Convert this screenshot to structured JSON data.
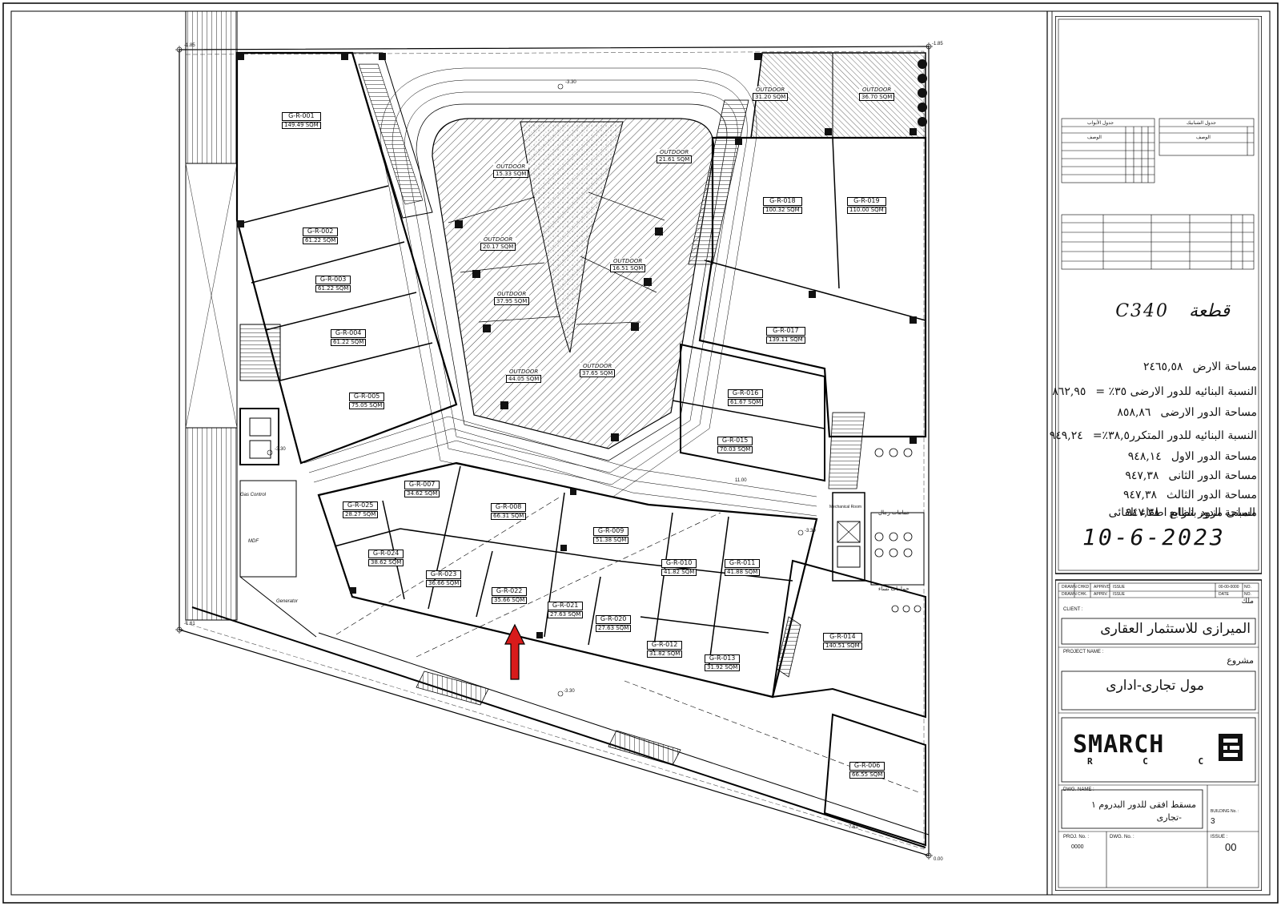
{
  "plot": {
    "title_label": "قطعة",
    "code": "C340",
    "stats": [
      {
        "label": "مساحة الارض",
        "value": "٢٤٦٥,٥٨"
      },
      {
        "label": "النسبة البنائيه للدور الارضى ٣٥٪ =",
        "value": "٨٦٢,٩٥"
      },
      {
        "label": "مساحة الدور الارضى",
        "value": "٨٥٨,٨٦"
      },
      {
        "label": "النسبة البنائيه للدور المتكرر٣٨,٥٪=",
        "value": "٩٤٩,٢٤"
      },
      {
        "label": "مساحة الدور الاول",
        "value": "٩٤٨,١٤"
      },
      {
        "label": "مساحة الدور الثانى",
        "value": "٩٤٧,٣٨"
      },
      {
        "label": "مساحة الدور الثالث",
        "value": "٩٤٧,٣٨"
      },
      {
        "label": "مساحة الدور الرابع",
        "value": "٩٤٧,٣٨"
      }
    ],
    "fire_note": "المبنى مزود بنظام اطفاء تلقائى",
    "date": "10-6-2023"
  },
  "title_block": {
    "rev_headers": [
      "DRAWN",
      "CHKD",
      "APPRVD",
      "ISSUE",
      "00-00-0000",
      "NO."
    ],
    "rev_headers2": [
      "DRAWN",
      "CHK.",
      "APPRV.",
      "ISSUE",
      "DATE",
      "NO."
    ],
    "owner_label": "ملك",
    "client_label": "CLIENT :",
    "client_name": "الميرازى للاستثمار العقارى",
    "project_label": "PROJECT NAME :",
    "project_ar_label": "مشروع",
    "project_name": "مول تجارى-ادارى",
    "logo_text": "SMARCH",
    "logo_sub": "R C C",
    "dwg_label": "DWG. NAME :",
    "dwg_name_1": "مسقط افقى للدور البدروم ١",
    "dwg_name_2": "-تجارى",
    "building_label": "BUILDING No. :",
    "building_no": "3",
    "proj_no_label": "PROJ. No. :",
    "proj_no": "0000",
    "dwg_no_label": "DWG. No. :",
    "issue_label": "ISSUE :",
    "issue_no": "00"
  },
  "units": [
    {
      "id": "G-R-001",
      "area": "149.49 SQM"
    },
    {
      "id": "G-R-002",
      "area": "61.22 SQM"
    },
    {
      "id": "G-R-003",
      "area": "61.22 SQM"
    },
    {
      "id": "G-R-004",
      "area": "61.22 SQM"
    },
    {
      "id": "G-R-005",
      "area": "75.05 SQM"
    },
    {
      "id": "G-R-006",
      "area": "66.55 SQM"
    },
    {
      "id": "G-R-007",
      "area": "34.62 SQM"
    },
    {
      "id": "G-R-008",
      "area": "66.31 SQM"
    },
    {
      "id": "G-R-009",
      "area": "51.38 SQM"
    },
    {
      "id": "G-R-010",
      "area": "41.82 SQM"
    },
    {
      "id": "G-R-011",
      "area": "41.88 SQM"
    },
    {
      "id": "G-R-012",
      "area": "31.82 SQM"
    },
    {
      "id": "G-R-013",
      "area": "31.92 SQM"
    },
    {
      "id": "G-R-014",
      "area": "140.51 SQM"
    },
    {
      "id": "G-R-015",
      "area": "70.03 SQM"
    },
    {
      "id": "G-R-016",
      "area": "61.67 SQM"
    },
    {
      "id": "G-R-017",
      "area": "139.11 SQM"
    },
    {
      "id": "G-R-018",
      "area": "100.32 SQM"
    },
    {
      "id": "G-R-019",
      "area": "110.00 SQM"
    },
    {
      "id": "G-R-020",
      "area": "27.63 SQM"
    },
    {
      "id": "G-R-021",
      "area": "27.63 SQM"
    },
    {
      "id": "G-R-022",
      "area": "35.66 SQM"
    },
    {
      "id": "G-R-023",
      "area": "36.66 SQM"
    },
    {
      "id": "G-R-024",
      "area": "38.62 SQM"
    },
    {
      "id": "G-R-025",
      "area": "28.27 SQM"
    }
  ],
  "outdoor": [
    {
      "label": "OUTDOOR",
      "area": "15.33 SQM"
    },
    {
      "label": "OUTDOOR",
      "area": "21.61 SQM"
    },
    {
      "label": "OUTDOOR",
      "area": "20.17 SQM"
    },
    {
      "label": "OUTDOOR",
      "area": "16.51 SQM"
    },
    {
      "label": "OUTDOOR",
      "area": "37.95 SQM"
    },
    {
      "label": "OUTDOOR",
      "area": "44.05 SQM"
    },
    {
      "label": "OUTDOOR",
      "area": "37.65 SQM"
    },
    {
      "label": "OUTDOOR",
      "area": "31.20 SQM"
    },
    {
      "label": "OUTDOOR",
      "area": "36.70 SQM"
    }
  ],
  "rooms": {
    "mdf": "MDF",
    "generator": "Generator",
    "gas": "Gas Control",
    "mens_wc": "حمامات رجال",
    "womens_wc": "حمامات نساء",
    "mech": "Mechanical Room"
  },
  "levels": [
    "-1.85",
    "-3.30",
    "-3.30",
    "-3.30",
    "-1.61",
    "-2.51",
    "0.00",
    "-3.30",
    "-1.85",
    "7.61",
    "11.00"
  ],
  "tables": {
    "doors_title": "جدول الأبواب",
    "windows_title": "جدول الشبابيك",
    "desc_label": "الوصف"
  },
  "arrow_color": "#d81b1b"
}
